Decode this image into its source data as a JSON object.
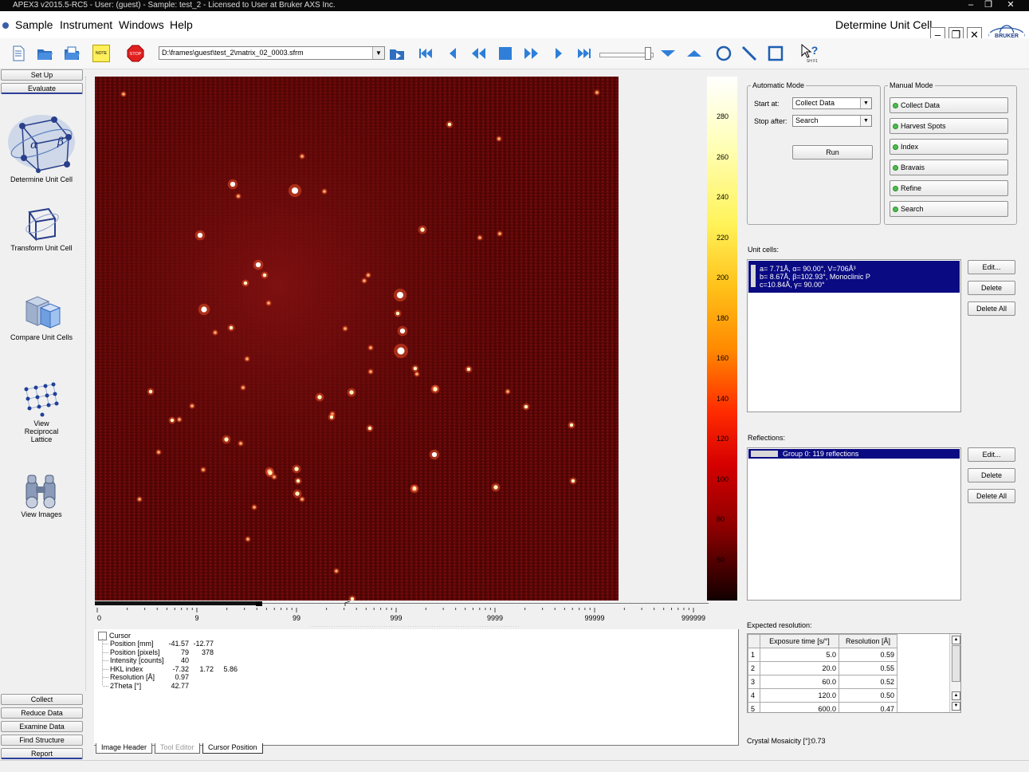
{
  "window": {
    "title": "APEX3 v2015.5-RC5 - User: (guest) - Sample: test_2 - Licensed to User at Bruker AXS Inc.",
    "module_title": "Determine Unit Cell"
  },
  "menu": [
    "Sample",
    "Instrument",
    "Windows",
    "Help"
  ],
  "toolbar": {
    "file_path": "D:\\frames\\guest\\test_2\\matrix_02_0003.sfrm",
    "note_label": "NOTE",
    "stop_label": "STOP",
    "help_label": "SH F1"
  },
  "nav": {
    "top_buttons": [
      "Set Up",
      "Evaluate"
    ],
    "items": [
      "Determine Unit Cell",
      "Transform Unit Cell",
      "Compare Unit Cells",
      "View Reciprocal Lattice",
      "View Images"
    ],
    "bottom_buttons": [
      "Collect",
      "Reduce Data",
      "Examine Data",
      "Find Structure",
      "Report"
    ]
  },
  "colorbar": {
    "labels": [
      "280",
      "260",
      "240",
      "220",
      "200",
      "180",
      "160",
      "140",
      "120",
      "100",
      "80",
      "60"
    ]
  },
  "ruler": {
    "labels": [
      "0",
      "9",
      "99",
      "999",
      "9999",
      "99999",
      "999999"
    ]
  },
  "cursor": {
    "title": "Cursor",
    "rows": [
      {
        "label": "Position [mm]",
        "values": [
          "-41.57",
          "-12.77",
          ""
        ]
      },
      {
        "label": "Position [pixels]",
        "values": [
          "79",
          "378",
          ""
        ]
      },
      {
        "label": "Intensity [counts]",
        "values": [
          "40",
          "",
          ""
        ]
      },
      {
        "label": "HKL index",
        "values": [
          "-7.32",
          "1.72",
          "5.86"
        ]
      },
      {
        "label": "Resolution [Å]",
        "values": [
          "0.97",
          "",
          ""
        ]
      },
      {
        "label": "2Theta [°]",
        "values": [
          "42.77",
          "",
          ""
        ]
      }
    ]
  },
  "tabs": [
    "Image Header",
    "Tool Editor",
    "Cursor Position"
  ],
  "auto_mode": {
    "legend": "Automatic Mode",
    "start_label": "Start at:",
    "start_value": "Collect Data",
    "stop_label": "Stop after:",
    "stop_value": "Search",
    "run_label": "Run"
  },
  "manual_mode": {
    "legend": "Manual Mode",
    "steps": [
      "Collect Data",
      "Harvest Spots",
      "Index",
      "Bravais",
      "Refine",
      "Search"
    ]
  },
  "unit_cells": {
    "label": "Unit cells:",
    "lines": [
      "a= 7.71Å,  α= 90.00°,  V=706Å³",
      "b=  8.67Å,  β=102.93°,  Monoclinic P",
      "c=10.84Å,  γ= 90.00°"
    ],
    "buttons": [
      "Edit...",
      "Delete",
      "Delete All"
    ]
  },
  "reflections": {
    "label": "Reflections:",
    "group": "Group 0: 119 reflections",
    "buttons": [
      "Edit...",
      "Delete",
      "Delete All"
    ]
  },
  "expected_resolution": {
    "label": "Expected resolution:",
    "headers": [
      "Exposure time [s/°]",
      "Resolution [Å]"
    ],
    "rows": [
      {
        "n": "1",
        "exposure": "5.0",
        "resolution": "0.59"
      },
      {
        "n": "2",
        "exposure": "20.0",
        "resolution": "0.55"
      },
      {
        "n": "3",
        "exposure": "60.0",
        "resolution": "0.52"
      },
      {
        "n": "4",
        "exposure": "120.0",
        "resolution": "0.50"
      },
      {
        "n": "5",
        "exposure": "600.0",
        "resolution": "0.47"
      }
    ]
  },
  "mosaicity": {
    "label": "Crystal Mosaicity [°]:",
    "value": "0.73"
  },
  "diffraction": {
    "spots": [
      [
        173,
        135,
        7
      ],
      [
        251,
        143,
        9
      ],
      [
        132,
        199,
        7
      ],
      [
        205,
        236,
        7
      ],
      [
        383,
        274,
        9
      ],
      [
        137,
        292,
        8
      ],
      [
        386,
        319,
        7
      ],
      [
        384,
        344,
        10
      ],
      [
        282,
        402,
        6
      ],
      [
        165,
        455,
        6
      ],
      [
        255,
        507,
        5
      ],
      [
        219,
        495,
        6
      ],
      [
        426,
        474,
        7
      ],
      [
        401,
        517,
        6
      ],
      [
        225,
        502,
        4
      ],
      [
        401,
        516,
        5
      ],
      [
        254,
        523,
        6
      ],
      [
        220,
        497,
        6
      ],
      [
        445,
        60,
        5
      ],
      [
        507,
        78,
        4
      ],
      [
        260,
        100,
        4
      ],
      [
        411,
        192,
        6
      ],
      [
        483,
        202,
        4
      ],
      [
        508,
        197,
        4
      ],
      [
        171,
        315,
        5
      ],
      [
        189,
        259,
        5
      ],
      [
        213,
        249,
        5
      ],
      [
        380,
        297,
        5
      ],
      [
        346,
        340,
        4
      ],
      [
        402,
        366,
        5
      ],
      [
        469,
        367,
        5
      ],
      [
        518,
        395,
        4
      ],
      [
        541,
        414,
        5
      ],
      [
        598,
        437,
        5
      ],
      [
        600,
        507,
        5
      ],
      [
        503,
        515,
        6
      ],
      [
        427,
        391,
        5
      ],
      [
        345,
        441,
        5
      ],
      [
        298,
        423,
        4
      ],
      [
        346,
        370,
        4
      ],
      [
        322,
        396,
        6
      ],
      [
        191,
        354,
        4
      ],
      [
        297,
        427,
        5
      ],
      [
        427,
        392,
        6
      ],
      [
        253,
        492,
        6
      ],
      [
        404,
        373,
        4
      ],
      [
        136,
        493,
        4
      ],
      [
        323,
        655,
        5
      ],
      [
        80,
        471,
        4
      ],
      [
        56,
        530,
        4
      ],
      [
        192,
        580,
        4
      ],
      [
        303,
        620,
        4
      ],
      [
        70,
        395,
        5
      ],
      [
        106,
        430,
        4
      ],
      [
        122,
        413,
        4
      ],
      [
        183,
        460,
        4
      ],
      [
        186,
        390,
        4
      ],
      [
        151,
        321,
        4
      ],
      [
        218,
        284,
        4
      ],
      [
        338,
        256,
        4
      ],
      [
        314,
        316,
        4
      ],
      [
        343,
        249,
        4
      ],
      [
        200,
        540,
        4
      ],
      [
        260,
        530,
        4
      ],
      [
        180,
        150,
        4
      ],
      [
        288,
        144,
        4
      ],
      [
        630,
        20,
        4
      ],
      [
        36,
        22,
        4
      ],
      [
        97,
        431,
        5
      ]
    ]
  }
}
